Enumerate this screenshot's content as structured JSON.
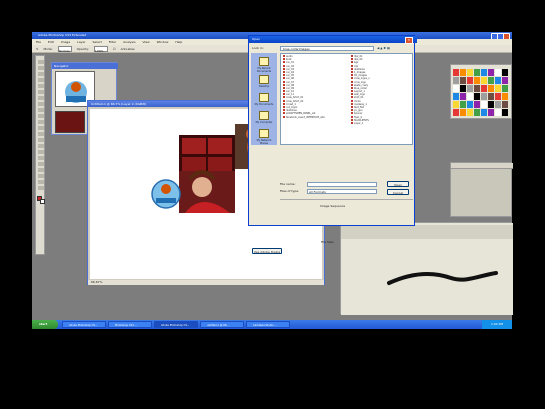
{
  "app": {
    "title": "Adobe Photoshop CS3 Extended",
    "menus": [
      "File",
      "Edit",
      "Image",
      "Layer",
      "Select",
      "Filter",
      "Analysis",
      "View",
      "Window",
      "Help"
    ],
    "options_bar": {
      "mode_label": "Mode:",
      "mode_value": "Normal",
      "opacity_label": "Opacity:",
      "opacity_value": "100%",
      "antialias_label": "Anti-alias",
      "workspace_label": "Workspace"
    }
  },
  "navigator": {
    "title": "Navigator"
  },
  "canvas_window": {
    "title": "Untitled-1 @ 66.7% (Layer 2, RGB/8)",
    "status": "66.67%"
  },
  "dialog": {
    "title": "Open",
    "lookin_label": "Look in:",
    "lookin_value": "blue-collarimages",
    "places": [
      "My Recent Documents",
      "Desktop",
      "My Documents",
      "My Computer",
      "My Network Places"
    ],
    "files_col1": [
      "audio",
      "boat",
      "car_01",
      "car_02",
      "car_03",
      "car_04",
      "car_05",
      "car_06",
      "car_07",
      "car_08",
      "car_09",
      "car_10",
      "car_11",
      "crew_tshirt_01",
      "crew_tshirt_02",
      "crowd_1",
      "cut_logos",
      "dustlines",
      "eCRAFTSMEN_PANEL_w2",
      "facebook_event_INTERFACE_site"
    ],
    "files_col2": [
      "dial_01",
      "dial_02",
      "bgs",
      "clip",
      "dustlines",
      "1_images",
      "02_images",
      "crew_logos_v",
      "crow_logo",
      "skate_crazy",
      "blue_collar",
      "Layout_1",
      "wall_logo",
      "shirt_01",
      "clicks",
      "roadway_1",
      "text_flat",
      "yo_gun",
      "banner",
      "flyer_b",
      "TextCLIENTS",
      "Layer_1"
    ],
    "filename_label": "File name:",
    "filetype_label": "Files of type:",
    "filetype_value": "All Formats",
    "open_label": "Open",
    "cancel_label": "Cancel",
    "preview_label": "Image Sequence",
    "size_label": "File Size:",
    "use_dialog_label": "Use Adobe Dialog"
  },
  "taskbar": {
    "start_label": "start",
    "tasks": [
      "Adobe Photoshop CS...",
      "Photoshop CS3 ...",
      "Adobe Photoshop CS...",
      "untitled-1 @ 66...",
      "Camtasia Studio ..."
    ],
    "clock": "1:04 PM"
  },
  "colors": {
    "titlebar": "#1d4fc4",
    "taskbar": "#2358d6",
    "start": "#2f8a2f",
    "desktop": "#000000"
  }
}
